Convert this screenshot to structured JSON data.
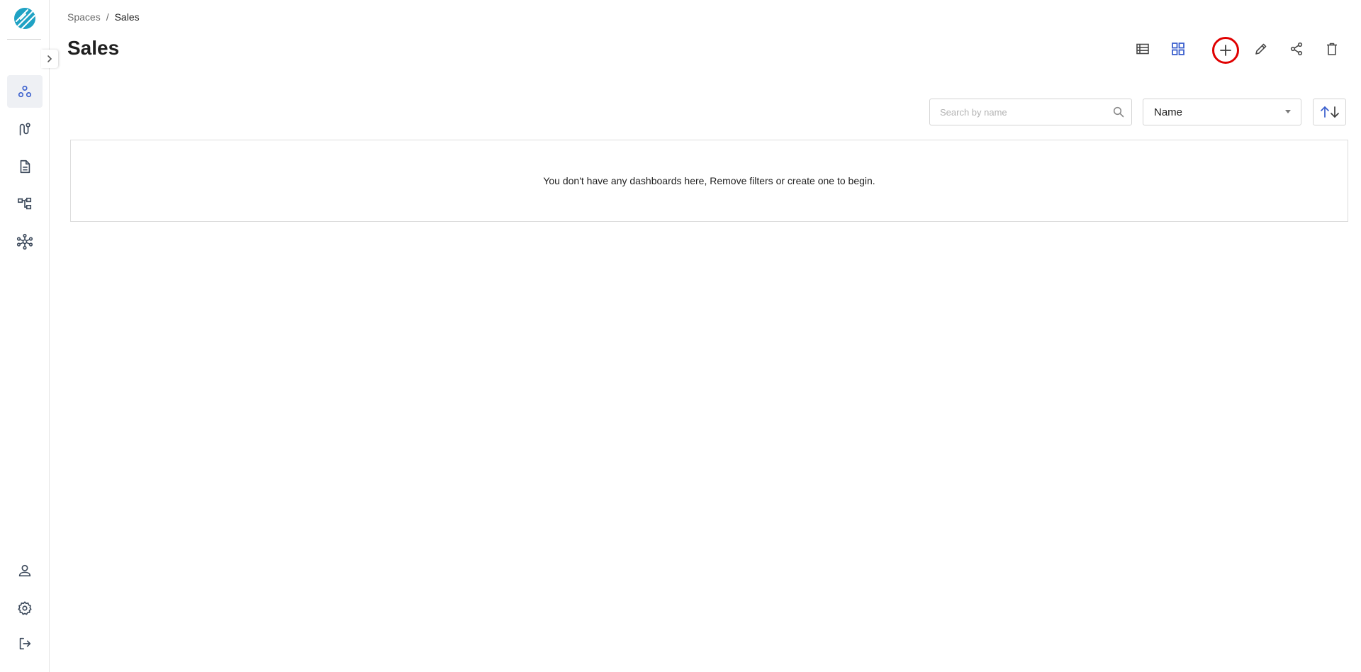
{
  "app": {
    "brand_color": "#1fa2c4",
    "accent": "#3a5fcd",
    "highlight_ring_color": "#e00000"
  },
  "sidebar": {
    "logo": "logo-icon",
    "expand_icon": "chevron-right-icon",
    "nav_items": [
      {
        "icon": "spaces-icon",
        "active": true
      },
      {
        "icon": "pipelines-icon",
        "active": false
      },
      {
        "icon": "documents-icon",
        "active": false
      },
      {
        "icon": "hierarchy-icon",
        "active": false
      },
      {
        "icon": "network-icon",
        "active": false
      }
    ],
    "bottom_items": [
      {
        "icon": "user-icon"
      },
      {
        "icon": "gear-icon"
      },
      {
        "icon": "logout-icon"
      }
    ]
  },
  "breadcrumb": {
    "root": "Spaces",
    "separator": "/",
    "current": "Sales"
  },
  "header": {
    "title": "Sales",
    "actions": [
      "list-view-icon",
      "grid-view-icon",
      "plus-icon",
      "pencil-icon",
      "share-icon",
      "trash-icon"
    ]
  },
  "filters": {
    "search": {
      "placeholder": "Search by name",
      "value": ""
    },
    "sort": {
      "selected": "Name"
    },
    "order_icon": "sort-order-icon"
  },
  "content": {
    "empty_message": "You don't have any dashboards here, Remove filters or create one to begin."
  }
}
